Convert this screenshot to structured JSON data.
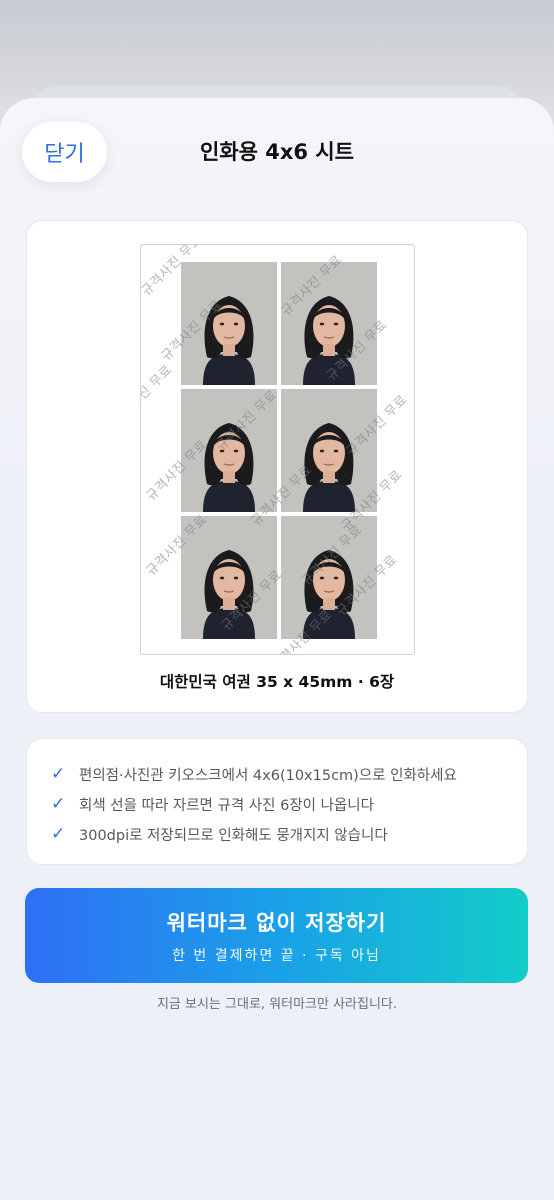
{
  "header": {
    "close_label": "닫기",
    "title": "인화용 4x6 시트"
  },
  "preview": {
    "caption": "대한민국 여권 35 x 45mm · 6장",
    "photo_count": 6,
    "watermark_text": "규격사진 무료"
  },
  "info": {
    "items": [
      "편의점·사진관 키오스크에서 4x6(10x15cm)으로 인화하세요",
      "회색 선을 따라 자르면 규격 사진 6장이 나옵니다",
      "300dpi로 저장되므로 인화해도 뭉개지지 않습니다"
    ]
  },
  "cta": {
    "main": "워터마크 없이 저장하기",
    "sub": "한 번 결제하면 끝 · 구독 아님",
    "gradient_start": "#2f6ff5",
    "gradient_end": "#12cdc8"
  },
  "footnote": "지금 보시는 그대로, 워터마크만 사라집니다.",
  "colors": {
    "accent": "#2f6fe0"
  }
}
